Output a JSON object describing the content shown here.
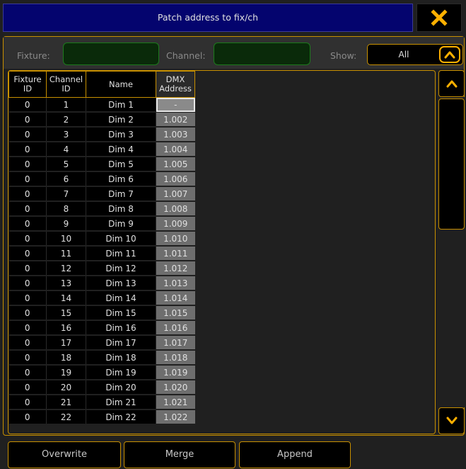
{
  "window": {
    "title": "Patch address to fix/ch"
  },
  "filter": {
    "fixture_label": "Fixture:",
    "fixture_value": "",
    "channel_label": "Channel:",
    "channel_value": "",
    "show_label": "Show:",
    "show_value": "All"
  },
  "table": {
    "headers": {
      "fixture_id": [
        "Fixture",
        "ID"
      ],
      "channel_id": [
        "Channel",
        "ID"
      ],
      "name": "Name",
      "dmx_address": [
        "DMX",
        "Address"
      ]
    },
    "rows": [
      {
        "fixture": "0",
        "channel": "1",
        "name": "Dim 1",
        "dmx": "-"
      },
      {
        "fixture": "0",
        "channel": "2",
        "name": "Dim 2",
        "dmx": "1.002"
      },
      {
        "fixture": "0",
        "channel": "3",
        "name": "Dim 3",
        "dmx": "1.003"
      },
      {
        "fixture": "0",
        "channel": "4",
        "name": "Dim 4",
        "dmx": "1.004"
      },
      {
        "fixture": "0",
        "channel": "5",
        "name": "Dim 5",
        "dmx": "1.005"
      },
      {
        "fixture": "0",
        "channel": "6",
        "name": "Dim 6",
        "dmx": "1.006"
      },
      {
        "fixture": "0",
        "channel": "7",
        "name": "Dim 7",
        "dmx": "1.007"
      },
      {
        "fixture": "0",
        "channel": "8",
        "name": "Dim 8",
        "dmx": "1.008"
      },
      {
        "fixture": "0",
        "channel": "9",
        "name": "Dim 9",
        "dmx": "1.009"
      },
      {
        "fixture": "0",
        "channel": "10",
        "name": "Dim 10",
        "dmx": "1.010"
      },
      {
        "fixture": "0",
        "channel": "11",
        "name": "Dim 11",
        "dmx": "1.011"
      },
      {
        "fixture": "0",
        "channel": "12",
        "name": "Dim 12",
        "dmx": "1.012"
      },
      {
        "fixture": "0",
        "channel": "13",
        "name": "Dim 13",
        "dmx": "1.013"
      },
      {
        "fixture": "0",
        "channel": "14",
        "name": "Dim 14",
        "dmx": "1.014"
      },
      {
        "fixture": "0",
        "channel": "15",
        "name": "Dim 15",
        "dmx": "1.015"
      },
      {
        "fixture": "0",
        "channel": "16",
        "name": "Dim 16",
        "dmx": "1.016"
      },
      {
        "fixture": "0",
        "channel": "17",
        "name": "Dim 17",
        "dmx": "1.017"
      },
      {
        "fixture": "0",
        "channel": "18",
        "name": "Dim 18",
        "dmx": "1.018"
      },
      {
        "fixture": "0",
        "channel": "19",
        "name": "Dim 19",
        "dmx": "1.019"
      },
      {
        "fixture": "0",
        "channel": "20",
        "name": "Dim 20",
        "dmx": "1.020"
      },
      {
        "fixture": "0",
        "channel": "21",
        "name": "Dim 21",
        "dmx": "1.021"
      },
      {
        "fixture": "0",
        "channel": "22",
        "name": "Dim 22",
        "dmx": "1.022"
      }
    ]
  },
  "buttons": {
    "overwrite": "Overwrite",
    "merge": "Merge",
    "append": "Append"
  },
  "icons": {
    "close": "close-icon",
    "show_dropdown": "chevron-up-icon",
    "scroll_up": "chevron-up-icon",
    "scroll_down": "chevron-down-icon"
  },
  "colors": {
    "title_bar": "#04046e",
    "accent": "#ffb000",
    "field_border": "#1c7a1c",
    "dmx_cell": "#6e6e6e"
  }
}
